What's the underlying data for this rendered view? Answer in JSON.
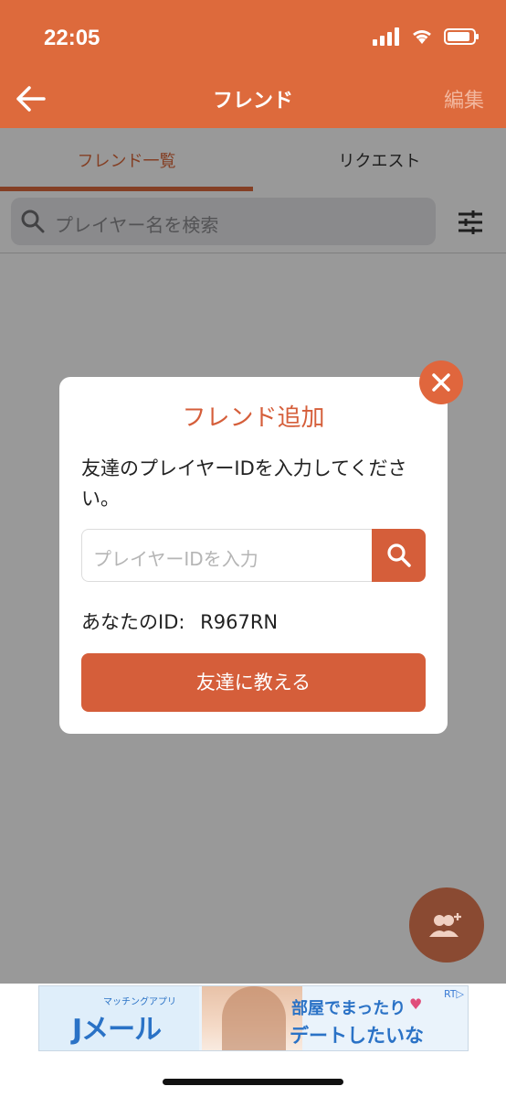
{
  "status_bar": {
    "time": "22:05"
  },
  "nav": {
    "title": "フレンド",
    "edit_label": "編集"
  },
  "tabs": [
    {
      "label": "フレンド一覧",
      "active": true
    },
    {
      "label": "リクエスト",
      "active": false
    }
  ],
  "search": {
    "placeholder": "プレイヤー名を検索"
  },
  "modal": {
    "title": "フレンド追加",
    "description": "友達のプレイヤーIDを入力してください。",
    "input_placeholder": "プレイヤーIDを入力",
    "your_id_label": "あなたのID:",
    "your_id_value": "R967RN",
    "share_button": "友達に教える"
  },
  "ad": {
    "brand": "Jメール",
    "brand_sub": "マッチングアプリ",
    "line1": "部屋でまったり",
    "line2": "デートしたいな",
    "badge": "RT▷"
  },
  "colors": {
    "accent": "#dd6a3c",
    "button": "#d55e3a"
  }
}
